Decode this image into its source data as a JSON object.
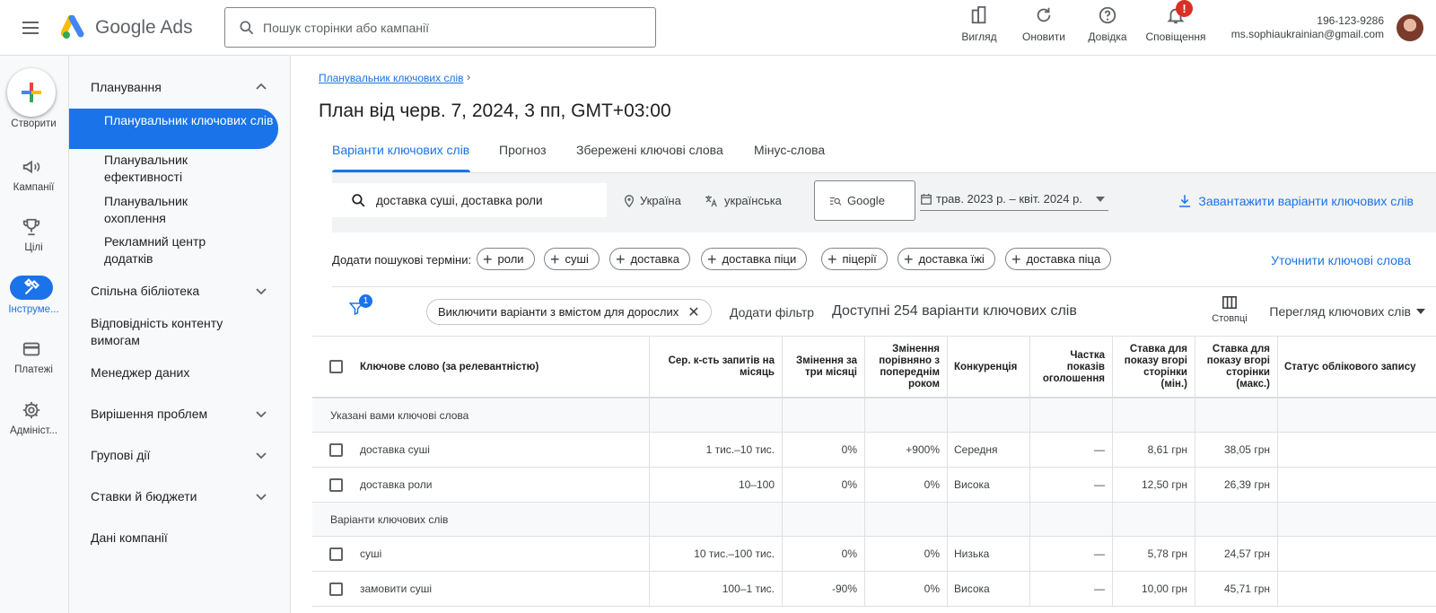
{
  "header": {
    "product_name": "Google Ads",
    "search_placeholder": "Пошук сторінки або кампанії",
    "actions": [
      {
        "label": "Вигляд",
        "icon": "appearance-icon"
      },
      {
        "label": "Оновити",
        "icon": "refresh-icon"
      },
      {
        "label": "Довідка",
        "icon": "help-icon"
      },
      {
        "label": "Сповіщення",
        "icon": "bell-icon",
        "badge": "!"
      }
    ],
    "account_id": "196-123-9286",
    "account_email": "ms.sophiaukrainian@gmail.com"
  },
  "rail": {
    "create": "Створити",
    "campaigns": "Кампанії",
    "goals": "Цілі",
    "tools": "Інструме...",
    "billing": "Платежі",
    "admin": "Адмініст..."
  },
  "sidenav": {
    "planning": "Планування",
    "keyword_planner": "Планувальник ключових слів",
    "performance_planner": "Планувальник ефективності",
    "reach_planner": "Планувальник охоплення",
    "app_center": "Рекламний центр додатків",
    "shared_library": "Спільна бібліотека",
    "content_suitability": "Відповідність контенту вимогам",
    "data_manager": "Менеджер даних",
    "troubleshooting": "Вирішення проблем",
    "bulk_actions": "Групові дії",
    "bids_budgets": "Ставки й бюджети",
    "business_data": "Дані компанії"
  },
  "main": {
    "breadcrumb": "Планувальник ключових слів",
    "title": "План від черв. 7, 2024, 3 пп, GMT+03:00",
    "tabs": [
      "Варіанти ключових слів",
      "Прогноз",
      "Збережені ключові слова",
      "Мінус-слова"
    ],
    "keywords_input": "доставка суші, доставка роли",
    "location": "Україна",
    "language": "українська",
    "network": "Google",
    "date_range": "трав. 2023 р. – квіт. 2024 р.",
    "download": "Завантажити варіанти ключових слів",
    "add_terms_label": "Додати пошукові терміни:",
    "term_chips": [
      "роли",
      "суші",
      "доставка",
      "доставка піци",
      "піцерії",
      "доставка їжі",
      "доставка піца"
    ],
    "refine": "Уточнити ключові слова",
    "filter_badge": "1",
    "exclude_chip": "Виключити варіанти з вмістом для дорослих",
    "add_filter": "Додати фільтр",
    "available": "Доступні 254 варіанти ключових слів",
    "columns": "Стовпці",
    "view": "Перегляд ключових слів"
  },
  "table": {
    "headers": {
      "keyword": "Ключове слово (за релевантністю)",
      "avg_searches": "Сер. к-сть запитів на місяць",
      "three_month": "Змінення за три місяці",
      "yoy": "Змінення порівняно з попереднім роком",
      "competition": "Конкуренція",
      "impr_share": "Частка показів оголошення",
      "bid_low": "Ставка для показу вгорі сторінки (мін.)",
      "bid_high": "Ставка для показу вгорі сторінки (макс.)",
      "status": "Статус облікового запису"
    },
    "group1": "Указані вами ключові слова",
    "group2": "Варіанти ключових слів",
    "rows": [
      {
        "keyword": "доставка суші",
        "avg": "1 тис.–10 тис.",
        "three": "0%",
        "yoy": "+900%",
        "comp": "Середня",
        "share": "—",
        "low": "8,61 грн",
        "high": "38,05 грн"
      },
      {
        "keyword": "доставка роли",
        "avg": "10–100",
        "three": "0%",
        "yoy": "0%",
        "comp": "Висока",
        "share": "—",
        "low": "12,50 грн",
        "high": "26,39 грн"
      },
      {
        "keyword": "суші",
        "avg": "10 тис.–100 тис.",
        "three": "0%",
        "yoy": "0%",
        "comp": "Низька",
        "share": "—",
        "low": "5,78 грн",
        "high": "24,57 грн"
      },
      {
        "keyword": "замовити суші",
        "avg": "100–1 тис.",
        "three": "-90%",
        "yoy": "0%",
        "comp": "Висока",
        "share": "—",
        "low": "10,00 грн",
        "high": "45,71 грн"
      }
    ]
  },
  "colors": {
    "accent": "#1a73e8",
    "alert": "#d93025"
  }
}
